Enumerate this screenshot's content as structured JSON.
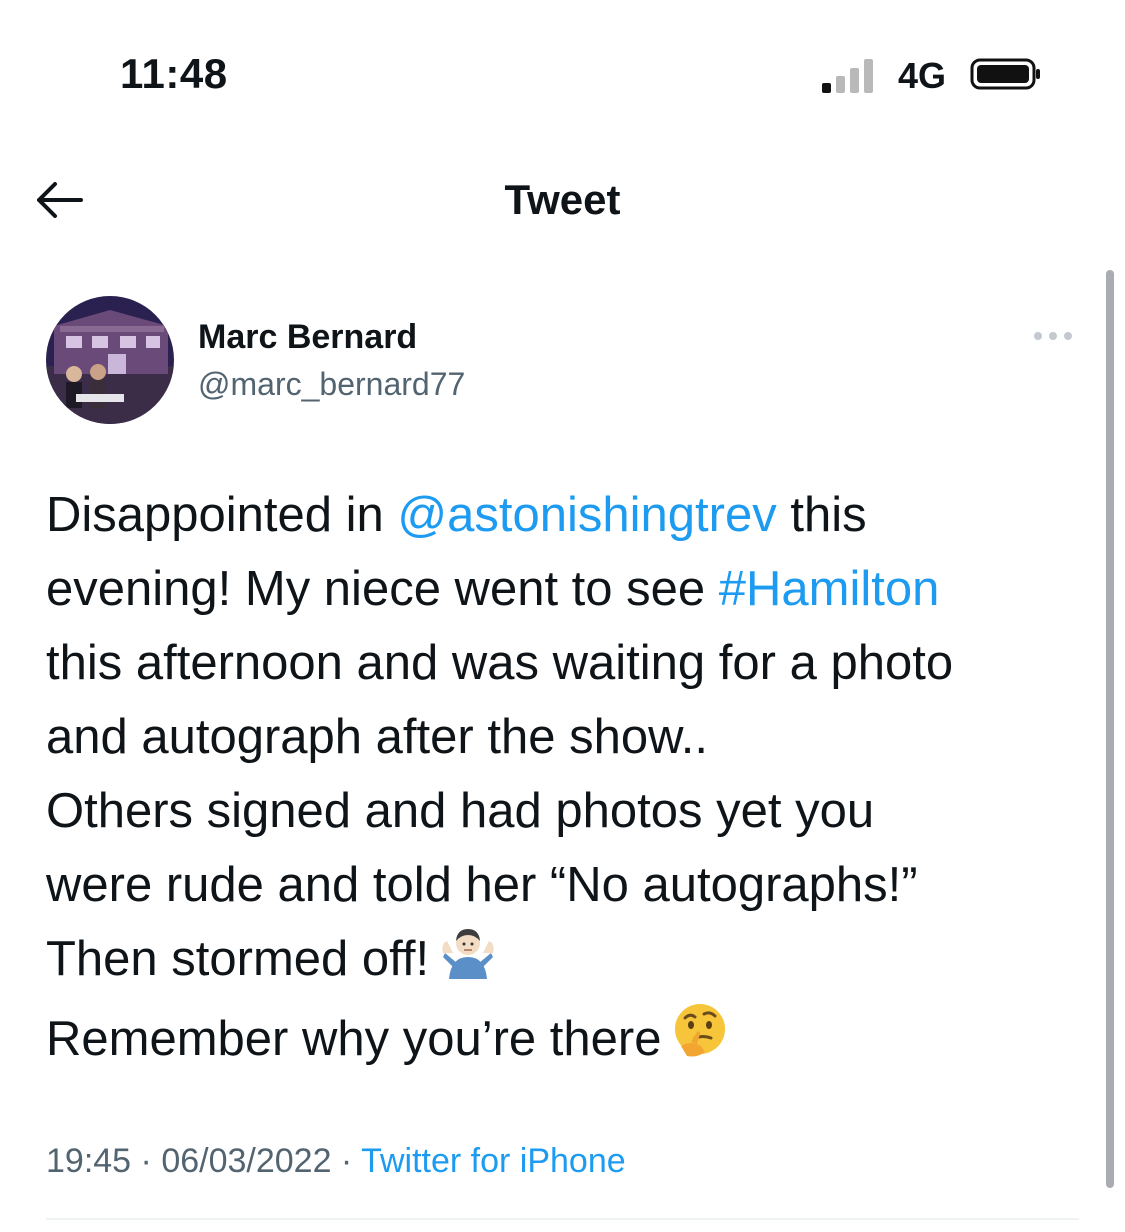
{
  "status_bar": {
    "time": "11:48",
    "network": "4G"
  },
  "nav": {
    "title": "Tweet"
  },
  "author": {
    "name": "Marc Bernard",
    "handle": "@marc_bernard77"
  },
  "tweet": {
    "lines": [
      [
        {
          "t": "Disappointed in "
        },
        {
          "t": "@astonishingtrev",
          "k": "mention"
        },
        {
          "t": " this"
        }
      ],
      [
        {
          "t": "evening! My niece went to see "
        },
        {
          "t": "#Hamilton",
          "k": "hashtag"
        }
      ],
      [
        {
          "t": "this afternoon and was waiting for a photo"
        }
      ],
      [
        {
          "t": "and autograph after the show.."
        }
      ],
      [
        {
          "t": "Others signed and had photos yet you"
        }
      ],
      [
        {
          "t": "were rude and told her “No autographs!”"
        }
      ],
      [
        {
          "t": "Then stormed off!"
        },
        {
          "emoji": "shrug-emoji"
        }
      ],
      [
        {
          "t": "Remember why you’re there"
        },
        {
          "emoji": "thinking-face-emoji"
        }
      ]
    ],
    "time": "19:45",
    "date": "06/03/2022",
    "separator": " · ",
    "source": "Twitter for iPhone"
  },
  "colors": {
    "link": "#1d9bf0",
    "secondary": "#536471",
    "text": "#0f1419"
  }
}
